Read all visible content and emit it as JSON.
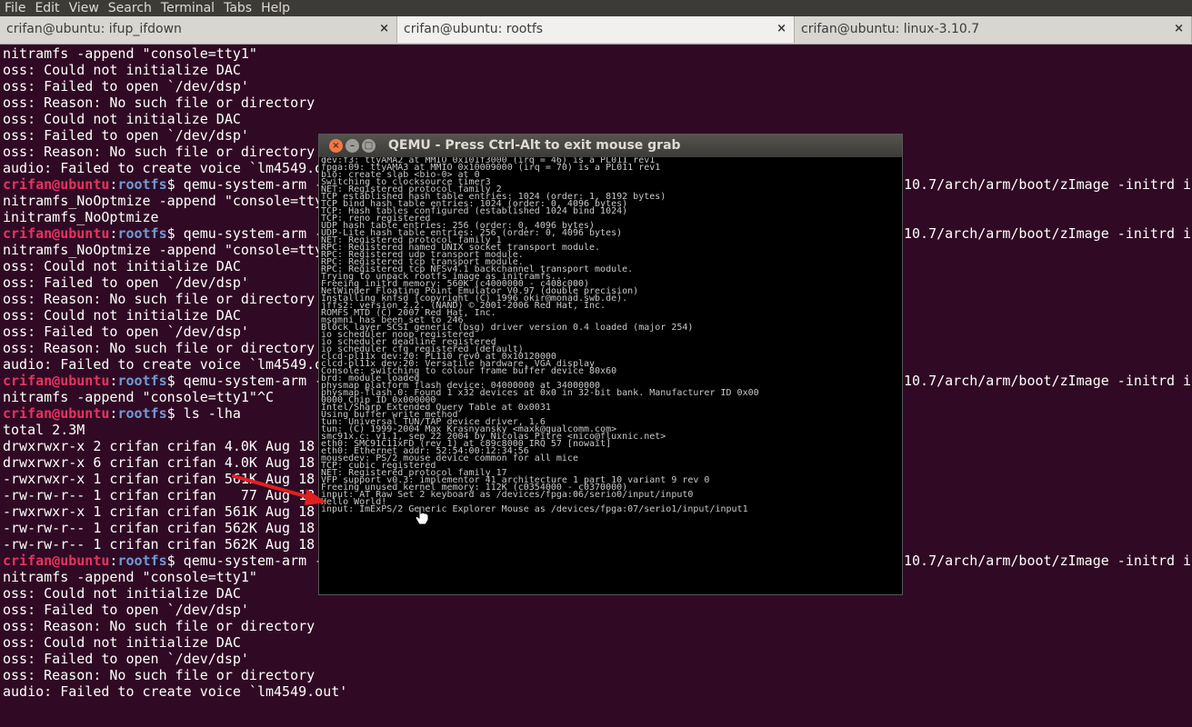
{
  "menu": [
    "File",
    "Edit",
    "View",
    "Search",
    "Terminal",
    "Tabs",
    "Help"
  ],
  "tabs": [
    {
      "label": "crifan@ubuntu: ifup_ifdown",
      "close": "×"
    },
    {
      "label": "crifan@ubuntu: rootfs",
      "close": "×"
    },
    {
      "label": "crifan@ubuntu: linux-3.10.7",
      "close": "×"
    }
  ],
  "terminal": {
    "prompt": {
      "user": "crifan@ubuntu",
      "sep": ":",
      "dir": "rootfs",
      "sym": "$"
    },
    "lines": [
      "nitramfs -append \"console=tty1\"",
      "oss: Could not initialize DAC",
      "oss: Failed to open `/dev/dsp'",
      "oss: Reason: No such file or directory",
      "oss: Could not initialize DAC",
      "oss: Failed to open `/dev/dsp'",
      "oss: Reason: No such file or directory",
      "audio: Failed to create voice `lm4549.o",
      " qemu-system-arm -",
      "nitramfs_NoOptmize -append \"console=tty",
      "initramfs_NoOptmize",
      " qemu-system-arm -",
      "nitramfs_NoOptmize -append \"console=tty",
      "oss: Could not initialize DAC",
      "oss: Failed to open `/dev/dsp'",
      "oss: Reason: No such file or directory",
      "oss: Could not initialize DAC",
      "oss: Failed to open `/dev/dsp'",
      "oss: Reason: No such file or directory",
      "audio: Failed to create voice `lm4549.o",
      " qemu-system-arm -",
      "nitramfs -append \"console=tty1\"^C",
      " ls -lha",
      "total 2.3M",
      "drwxrwxr-x 2 crifan crifan 4.0K Aug 18",
      "drwxrwxr-x 6 crifan crifan 4.0K Aug 18",
      "-rwxrwxr-x 1 crifan crifan 561K Aug 18",
      "-rw-rw-r-- 1 crifan crifan   77 Aug 18",
      "-rwxrwxr-x 1 crifan crifan 561K Aug 18",
      "-rw-rw-r-- 1 crifan crifan 562K Aug 18",
      "-rw-rw-r-- 1 crifan crifan 562K Aug 18",
      " qemu-system-arm -",
      "nitramfs -append \"console=tty1\"",
      "oss: Could not initialize DAC",
      "oss: Failed to open `/dev/dsp'",
      "oss: Reason: No such file or directory",
      "oss: Could not initialize DAC",
      "oss: Failed to open `/dev/dsp'",
      "oss: Reason: No such file or directory",
      "audio: Failed to create voice `lm4549.out'"
    ],
    "tail_text": "10.7/arch/arm/boot/zImage -initrd i"
  },
  "qemu": {
    "title": "QEMU - Press Ctrl-Alt to exit mouse grab",
    "lines": [
      "dev:f3: ttyAMA2 at MMIO 0x101f3000 (irq = 46) is a PL011 rev1",
      "fpga:09: ttyAMA3 at MMIO 0x10009000 (irq = 70) is a PL011 rev1",
      "bio: create slab <bio-0> at 0",
      "Switching to clocksource timer3",
      "NET: Registered protocol family 2",
      "TCP established hash table entries: 1024 (order: 1, 8192 bytes)",
      "TCP bind hash table entries: 1024 (order: 0, 4096 bytes)",
      "TCP: Hash tables configured (established 1024 bind 1024)",
      "TCP: reno registered",
      "UDP hash table entries: 256 (order: 0, 4096 bytes)",
      "UDP-Lite hash table entries: 256 (order: 0, 4096 bytes)",
      "NET: Registered protocol family 1",
      "RPC: Registered named UNIX socket transport module.",
      "RPC: Registered udp transport module.",
      "RPC: Registered tcp transport module.",
      "RPC: Registered tcp NFSv4.1 backchannel transport module.",
      "Trying to unpack rootfs image as initramfs...",
      "Freeing initrd memory: 560K (c4000000 - c408c000)",
      "NetWinder Floating Point Emulator V0.97 (double precision)",
      "Installing knfsd (copyright (C) 1996 okir@monad.swb.de).",
      "jffs2: version 2.2. (NAND) © 2001-2006 Red Hat, Inc.",
      "ROMFS MTD (C) 2007 Red Hat, Inc.",
      "msgmni has been set to 246",
      "Block layer SCSI generic (bsg) driver version 0.4 loaded (major 254)",
      "io scheduler noop registered",
      "io scheduler deadline registered",
      "io scheduler cfq registered (default)",
      "clcd-pl11x dev:20: PL110 rev0 at 0x10120000",
      "clcd-pl11x dev:20: Versatile hardware, VGA display",
      "Console: switching to colour frame buffer device 80x60",
      "brd: module loaded",
      "physmap platform flash device: 04000000 at 34000000",
      "physmap-flash.0: Found 1 x32 devices at 0x0 in 32-bit bank. Manufacturer ID 0x00",
      "0000 Chip ID 0x000000",
      "Intel/Sharp Extended Query Table at 0x0031",
      "Using buffer write method",
      "tun: Universal TUN/TAP device driver, 1.6",
      "tun: (C) 1999-2004 Max Krasnyansky <maxk@qualcomm.com>",
      "smc91x.c: v1.1, sep 22 2004 by Nicolas Pitre <nico@fluxnic.net>",
      "eth0: SMC91C11xFD (rev 1) at c89c8000 IRQ 57 [nowait]",
      "eth0: Ethernet addr: 52:54:00:12:34:56",
      "mousedev: PS/2 mouse device common for all mice",
      "TCP: cubic registered",
      "NET: Registered protocol family 17",
      "VFP support v0.3: implementor 41 architecture 1 part 10 variant 9 rev 0",
      "Freeing unused kernel memory: 112K (c0354000 - c0370000)",
      "input: AT Raw Set 2 keyboard as /devices/fpga:06/serio0/input/input0",
      "Hello World!",
      "input: ImExPS/2 Generic Explorer Mouse as /devices/fpga:07/serio1/input/input1"
    ]
  },
  "colors": {
    "terminal_bg": "#300a24",
    "prompt_user": "#e5345e",
    "prompt_dir": "#6f9bd6",
    "arrow": "#e02020"
  }
}
